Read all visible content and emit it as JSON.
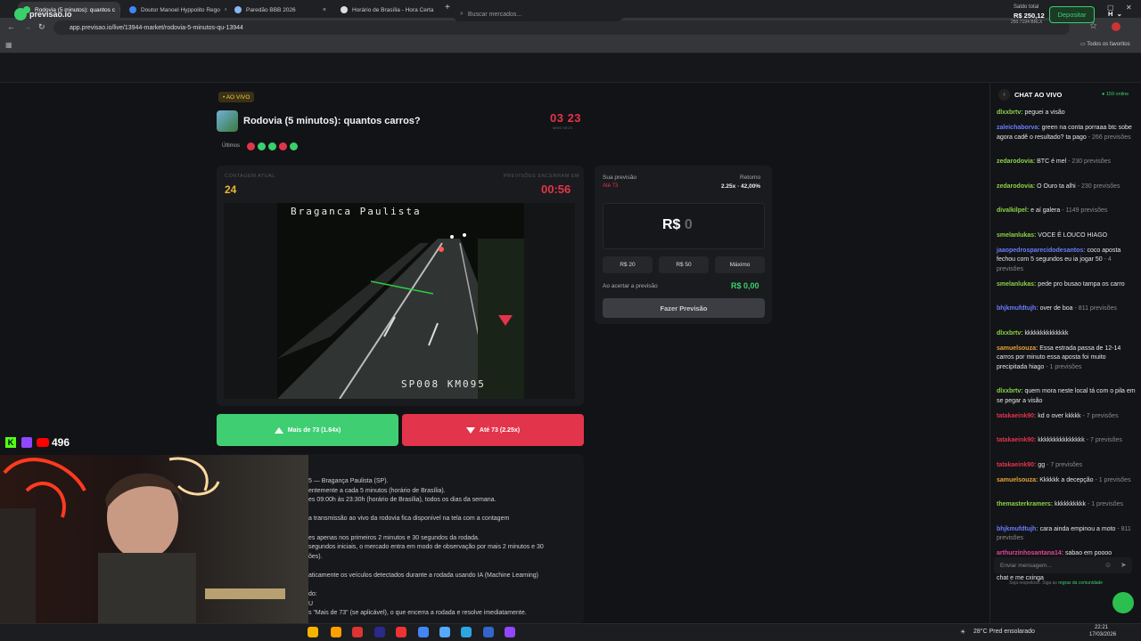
{
  "browser": {
    "tabs": [
      {
        "title": "Rodovia (5 minutos): quantos c",
        "active": true,
        "color": "#3ad06b"
      },
      {
        "title": "Doutor Manoel Hyppolito Rego",
        "active": false,
        "color": "#4285f4"
      },
      {
        "title": "Paredão BBB 2026",
        "active": false,
        "color": "#8ab4f8"
      },
      {
        "title": "Horário de Brasília - Hora Certa",
        "active": false,
        "color": "#dddddd"
      }
    ],
    "new_tab": "+",
    "url": "app.previsao.io/live/13944-market/rodovia-5-minutos-qu-13944",
    "bookmarks_all": "Todos os favoritos"
  },
  "site": {
    "logo": "previsao.io",
    "search_placeholder": "Buscar mercados...",
    "saldo_label": "Saldo total",
    "saldo_value": "R$ 250,12",
    "saldo_sub": "250.7194 BRLX",
    "deposit_label": "Depositar",
    "user_initial": "H"
  },
  "market": {
    "live_badge": "• AO VIVO",
    "title": "Rodovia (5 minutos): quantos carros?",
    "timer": "03 23",
    "timer_sub": "MINS    SECS",
    "ultimos_label": "Últimos",
    "ultimos": [
      "down",
      "up",
      "up",
      "down",
      "up"
    ],
    "count_label": "CONTAGEM ATUAL",
    "count_value": "24",
    "closing_label": "PREVISÕES ENCERRAM EM",
    "closing_value": "00:56",
    "cam_top": "Braganca Paulista",
    "cam_bottom": "SP008 KM095",
    "btn_more": "Mais de 73 (1.64x)",
    "btn_less": "Até 73 (2.25x)"
  },
  "description": [
    "5 — Bragança Paulista (SP).",
    "entemente a cada 5 minutos (horário de Brasília).",
    "es 09:00h às 23:30h (horário de Brasília), todos os dias da semana.",
    "",
    "a transmissão ao vivo da rodovia fica disponível na tela com a contagem",
    "",
    "es apenas nos primeiros 2 minutos e 30 segundos da rodada.",
    "segundos iniciais, o mercado entra em modo de observação por mais 2 minutos e 30",
    "ões).",
    "",
    "aticamente os veículos detectados durante a rodada usando IA (Machine Learning)",
    "",
    "do:",
    "U",
    "s \"Mais de 73\" (se aplicável), o que encerra a rodada e resolve imediatamente."
  ],
  "prediction": {
    "your_label": "Sua previsão",
    "your_value": "Até 73",
    "return_label": "Retorno",
    "return_value": "2.25x · 42,00%",
    "amount_prefix": "R$",
    "amount_value": "0",
    "quick": [
      "R$ 20",
      "R$ 50",
      "Máximo"
    ],
    "win_label": "Ao acertar a previsão",
    "win_value": "R$ 0,00",
    "submit": "Fazer Previsão"
  },
  "chat": {
    "title": "CHAT AO VIVO",
    "online": "● 159 online",
    "messages": [
      {
        "user": "dlxxbrtv:",
        "color": "#8bd14a",
        "text": " peguei a visão",
        "note": ""
      },
      {
        "user": "zaleichaborva:",
        "color": "#6a7dff",
        "text": " green na conta porraaa btc sobe agora cadê o resultado? ta pago",
        "note": " - 266 previsões"
      },
      {
        "user": "zedarodovia:",
        "color": "#8bd14a",
        "text": " BTC é mel",
        "note": " - 230 previsões"
      },
      {
        "user": "zedarodovia:",
        "color": "#8bd14a",
        "text": " O Ouro ta alhi",
        "note": " - 230 previsões"
      },
      {
        "user": "divalkilpel:",
        "color": "#8bd14a",
        "text": " e aí galera",
        "note": " - 1149 previsões"
      },
      {
        "user": "smelanlukas:",
        "color": "#8bd14a",
        "text": " VOCE É LOUCO HIAGO",
        "note": ""
      },
      {
        "user": "jaaopedrosparecidodesantos:",
        "color": "#6a7dff",
        "text": " coco aposta fechou com 5 segundos eu ia jogar 50",
        "note": " - 4 previsões"
      },
      {
        "user": "smelanlukas:",
        "color": "#8bd14a",
        "text": " pede pro busao tampa os carro",
        "note": ""
      },
      {
        "user": "bhjkmufdtujh:",
        "color": "#6a7dff",
        "text": " over de boa",
        "note": " - 811 previsões"
      },
      {
        "user": "dlxxbrtv:",
        "color": "#8bd14a",
        "text": " kkkkkkkkkkkkkk",
        "note": ""
      },
      {
        "user": "samuelsouza:",
        "color": "#e8a33a",
        "text": " Essa estrada passa de 12-14 carros por minuto essa aposta foi muito precipitada hiago",
        "note": " - 1 previsões"
      },
      {
        "user": "dlxxbrtv:",
        "color": "#8bd14a",
        "text": " quem mora neste local tá com o pila em se pegar a visão",
        "note": ""
      },
      {
        "user": "tatakaeink90:",
        "color": "#e2344a",
        "text": " kd o over kkkkk",
        "note": " - 7 previsões"
      },
      {
        "user": "tatakaeink90:",
        "color": "#e2344a",
        "text": " kkkkkkkkkkkkkkk",
        "note": " - 7 previsões"
      },
      {
        "user": "tatakaeink90:",
        "color": "#e2344a",
        "text": " gg",
        "note": " - 7 previsões"
      },
      {
        "user": "samuelsouza:",
        "color": "#e8a33a",
        "text": " Kkkkkk a decepção",
        "note": " - 1 previsões"
      },
      {
        "user": "themasterkramers:",
        "color": "#8bd14a",
        "text": " kkkkkkkkkk",
        "note": " - 1 previsões"
      },
      {
        "user": "bhjkmufdtujh:",
        "color": "#6a7dff",
        "text": " cara ainda empinou a moto",
        "note": " - 811 previsões"
      },
      {
        "user": "arthurzinhosantana14:",
        "color": "#e2449a",
        "text": " sabao em poooo",
        "note": ""
      },
      {
        "user": "arthurzinhosantana14:",
        "color": "#e2449a",
        "text": " thiago me nota aqui no chat e me cxinga",
        "note": ""
      }
    ],
    "input_placeholder": "Enviar mensagem...",
    "note_text": "Seja respeitoso. Siga as",
    "note_link": "regras da comunidade"
  },
  "overlay": {
    "k": "K",
    "viewers": "496"
  },
  "taskbar": {
    "weather": "28°C  Pred ensolarado",
    "time": "22:21",
    "date": "17/03/2026"
  }
}
